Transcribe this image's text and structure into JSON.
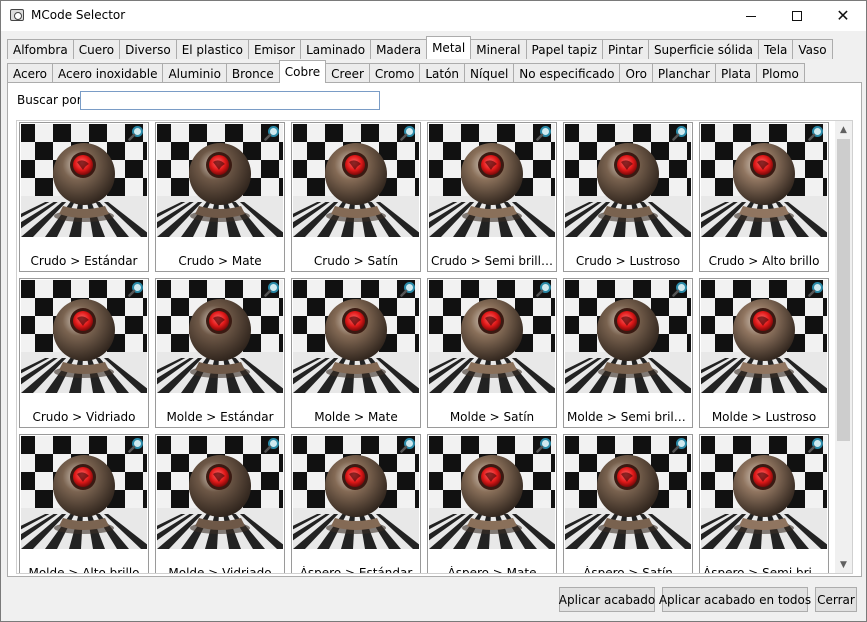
{
  "window": {
    "title": "MCode Selector"
  },
  "tabs_row1": [
    {
      "label": "Alfombra",
      "active": false
    },
    {
      "label": "Cuero",
      "active": false
    },
    {
      "label": "Diverso",
      "active": false
    },
    {
      "label": "El plastico",
      "active": false
    },
    {
      "label": "Emisor",
      "active": false
    },
    {
      "label": "Laminado",
      "active": false
    },
    {
      "label": "Madera",
      "active": false
    },
    {
      "label": "Metal",
      "active": true
    },
    {
      "label": "Mineral",
      "active": false
    },
    {
      "label": "Papel tapiz",
      "active": false
    },
    {
      "label": "Pintar",
      "active": false
    },
    {
      "label": "Superficie sólida",
      "active": false
    },
    {
      "label": "Tela",
      "active": false
    },
    {
      "label": "Vaso",
      "active": false
    }
  ],
  "tabs_row2": [
    {
      "label": "Acero",
      "active": false
    },
    {
      "label": "Acero inoxidable",
      "active": false
    },
    {
      "label": "Aluminio",
      "active": false
    },
    {
      "label": "Bronce",
      "active": false
    },
    {
      "label": "Cobre",
      "active": true
    },
    {
      "label": "Creer",
      "active": false
    },
    {
      "label": "Cromo",
      "active": false
    },
    {
      "label": "Latón",
      "active": false
    },
    {
      "label": "Níquel",
      "active": false
    },
    {
      "label": "No especificado",
      "active": false
    },
    {
      "label": "Oro",
      "active": false
    },
    {
      "label": "Planchar",
      "active": false
    },
    {
      "label": "Plata",
      "active": false
    },
    {
      "label": "Plomo",
      "active": false
    }
  ],
  "search": {
    "label": "Buscar por:",
    "value": "",
    "placeholder": ""
  },
  "materials": [
    {
      "label": "Crudo > Estándar"
    },
    {
      "label": "Crudo > Mate"
    },
    {
      "label": "Crudo > Satín"
    },
    {
      "label": "Crudo > Semi brillante"
    },
    {
      "label": "Crudo > Lustroso"
    },
    {
      "label": "Crudo > Alto brillo"
    },
    {
      "label": "Crudo > Vidriado"
    },
    {
      "label": "Molde > Estándar"
    },
    {
      "label": "Molde > Mate"
    },
    {
      "label": "Molde > Satín"
    },
    {
      "label": "Molde > Semi brillan..."
    },
    {
      "label": "Molde > Lustroso"
    },
    {
      "label": "Molde > Alto brillo"
    },
    {
      "label": "Molde > Vidriado"
    },
    {
      "label": "Áspero > Estándar"
    },
    {
      "label": "Áspero > Mate"
    },
    {
      "label": "Áspero > Satín"
    },
    {
      "label": "Áspero > Semi brillo"
    }
  ],
  "icons": {
    "zoom": "magnifier-icon",
    "app": "app-icon"
  },
  "buttons": {
    "apply": "Aplicar acabado",
    "apply_all": "Aplicar acabado en todos",
    "close": "Cerrar"
  },
  "colors": {
    "accent_border": "#7a9cc6",
    "sphere_highlight": "#e02020",
    "copper": "#7a6450"
  }
}
